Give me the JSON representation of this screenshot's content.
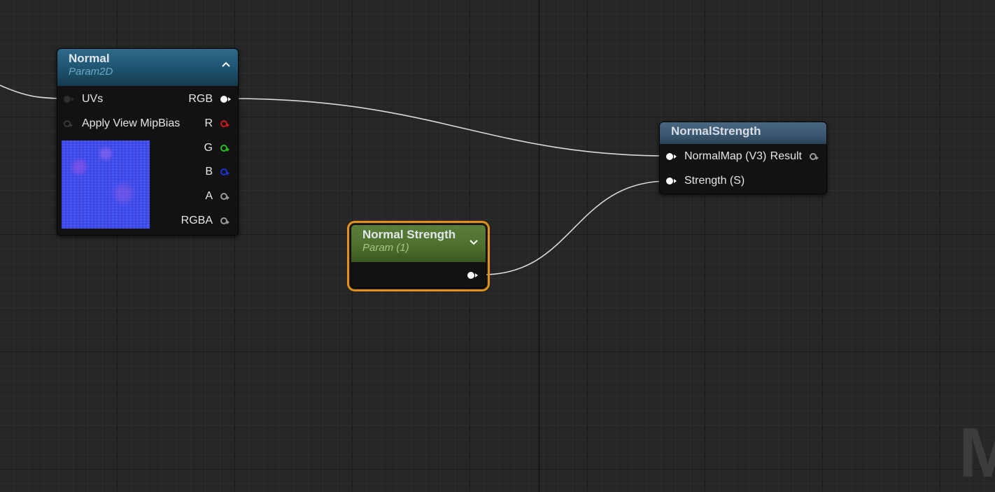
{
  "nodes": {
    "normal_tex": {
      "title": "Normal",
      "subtitle": "Param2D",
      "inputs": [
        "UVs",
        "Apply View MipBias"
      ],
      "outputs": [
        "RGB",
        "R",
        "G",
        "B",
        "A",
        "RGBA"
      ]
    },
    "normal_strength_param": {
      "title": "Normal Strength",
      "subtitle": "Param (1)"
    },
    "normal_strength_fn": {
      "title": "NormalStrength",
      "input_normal": "NormalMap (V3)",
      "output_result": "Result",
      "input_strength": "Strength (S)"
    }
  },
  "watermark": "M",
  "colors": {
    "selection": "#e3901a",
    "pin_r": "#d31919",
    "pin_g": "#25c025",
    "pin_b": "#1b32d6"
  },
  "icons": {
    "collapse": "chevron-up-icon",
    "expand": "chevron-down-icon"
  }
}
